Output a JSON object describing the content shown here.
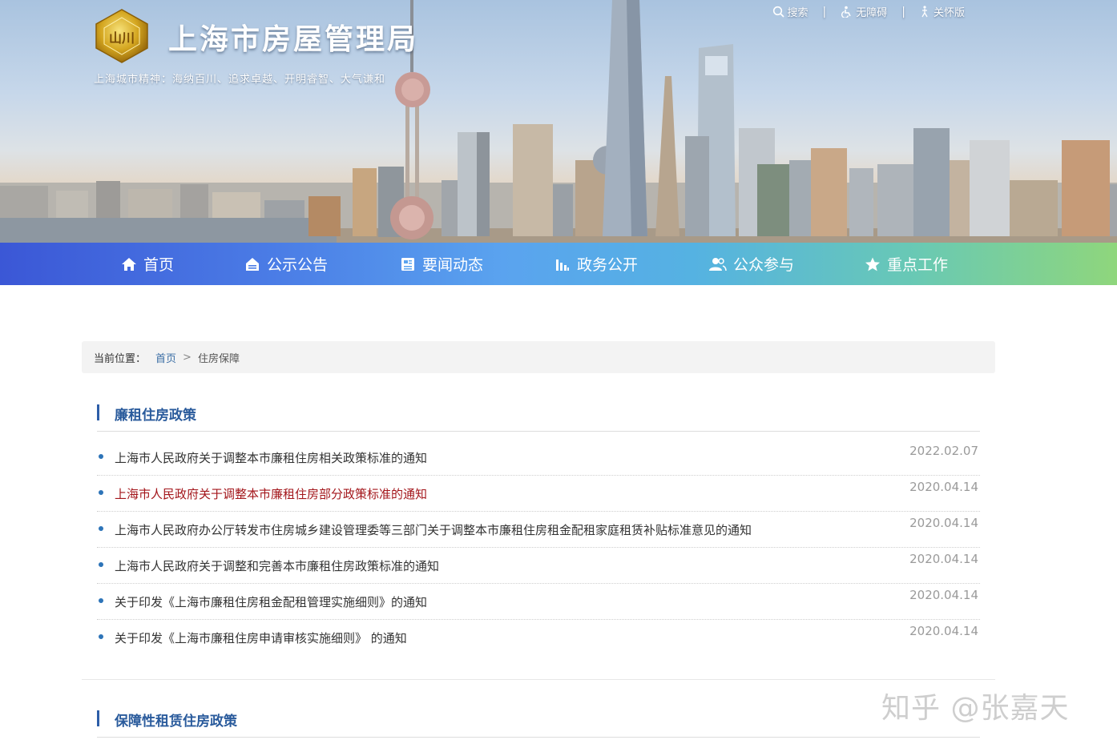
{
  "header": {
    "title": "上海市房屋管理局",
    "slogan": "上海城市精神：海纳百川、追求卓越、开明睿智、大气谦和",
    "logo_text": "山川",
    "links": [
      {
        "label": "搜索",
        "icon": "search-icon"
      },
      {
        "label": "无障碍",
        "icon": "accessibility-icon"
      },
      {
        "label": "关怀版",
        "icon": "care-icon"
      }
    ],
    "separator": "|"
  },
  "nav": {
    "items": [
      {
        "label": "首页",
        "icon": "home-icon"
      },
      {
        "label": "公示公告",
        "icon": "announcement-icon"
      },
      {
        "label": "要闻动态",
        "icon": "news-icon"
      },
      {
        "label": "政务公开",
        "icon": "chart-icon"
      },
      {
        "label": "公众参与",
        "icon": "users-icon"
      },
      {
        "label": "重点工作",
        "icon": "star-icon"
      }
    ]
  },
  "breadcrumb": {
    "label": "当前位置：",
    "home": "首页",
    "separator": ">",
    "current": "住房保障"
  },
  "sections": [
    {
      "title": "廉租住房政策",
      "items": [
        {
          "title": "上海市人民政府关于调整本市廉租住房相关政策标准的通知",
          "date": "2022.02.07"
        },
        {
          "title": "上海市人民政府关于调整本市廉租住房部分政策标准的通知",
          "date": "2020.04.14"
        },
        {
          "title": "上海市人民政府办公厅转发市住房城乡建设管理委等三部门关于调整本市廉租住房租金配租家庭租赁补贴标准意见的通知",
          "date": "2020.04.14"
        },
        {
          "title": "上海市人民政府关于调整和完善本市廉租住房政策标准的通知",
          "date": "2020.04.14"
        },
        {
          "title": "关于印发《上海市廉租住房租金配租管理实施细则》的通知",
          "date": "2020.04.14"
        },
        {
          "title": "关于印发《上海市廉租住房申请审核实施细则》 的通知",
          "date": "2020.04.14"
        }
      ]
    },
    {
      "title": "保障性租赁住房政策",
      "items": []
    }
  ],
  "watermark": "知乎 @张嘉天",
  "colors": {
    "accent": "#2a5b9c",
    "link_active": "#a3161b",
    "date": "#9a9a9a",
    "nav_start": "#3b57d6",
    "nav_end": "#8fd67c"
  }
}
